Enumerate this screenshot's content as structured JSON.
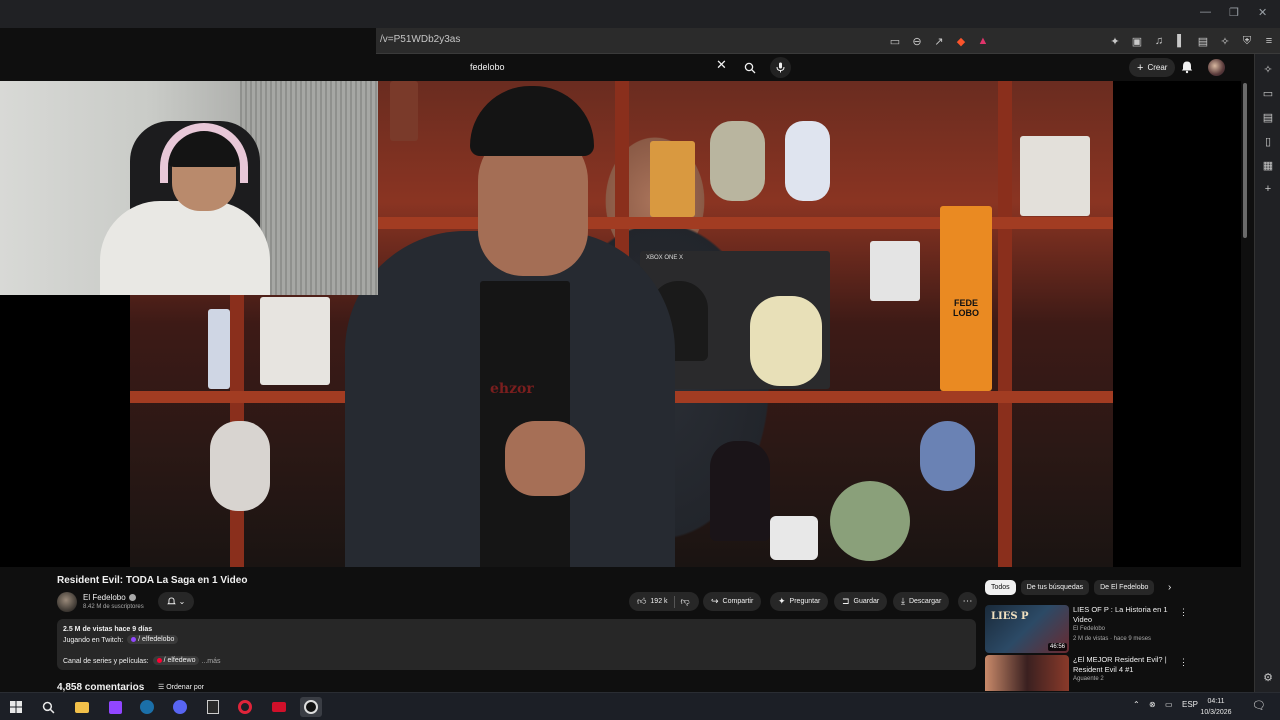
{
  "browser": {
    "url": "/v=P51WDb2y3as",
    "window_controls": [
      "—",
      "❐"
    ]
  },
  "youtube_header": {
    "search_value": "fedelobo",
    "create_label": "Crear"
  },
  "video": {
    "title": "Resident Evil: TODA La Saga en 1 Video",
    "channel_name": "El Fedelobo",
    "channel_subs": "8.42 M de suscriptores",
    "likes": "192 k",
    "share_label": "Compartir",
    "ask_label": "Preguntar",
    "save_label": "Guardar",
    "download_label": "Descargar",
    "shirt_text": "ehzor",
    "xbox_text": "XBOX ONE X",
    "poster_text": "FEDE LOBO"
  },
  "description": {
    "stats": "2.5 M de vistas  hace 9 días",
    "twitch_prefix": "Jugando en Twitch:",
    "twitch_handle": "/ elfedelobo",
    "series_prefix": "Canal de series y películas:",
    "series_handle": "/ elfedewo",
    "more": "...más"
  },
  "comments": {
    "count_label": "4,858 comentarios",
    "sort_label": "Ordenar por"
  },
  "chips": [
    {
      "label": "Todos",
      "active": true
    },
    {
      "label": "De tus búsquedas",
      "active": false
    },
    {
      "label": "De El Fedelobo",
      "active": false
    }
  ],
  "recommendations": [
    {
      "title": "LIES OF P : La Historia en 1 Video",
      "channel": "El Fedelobo",
      "meta": "2 M de vistas · hace 9 meses",
      "duration": "46:56",
      "thumb_text": "LIES P"
    },
    {
      "title": "¿El MEJOR Resident Evil? | Resident Evil 4 #1",
      "channel": "Aguaente 2",
      "meta": "",
      "duration": ""
    }
  ],
  "taskbar": {
    "language": "ESP",
    "time": "04:11",
    "date": "10/3/2026"
  },
  "colors": {
    "accent": "#3ea6ff",
    "background": "#0f0f0f",
    "surface": "#272727"
  }
}
